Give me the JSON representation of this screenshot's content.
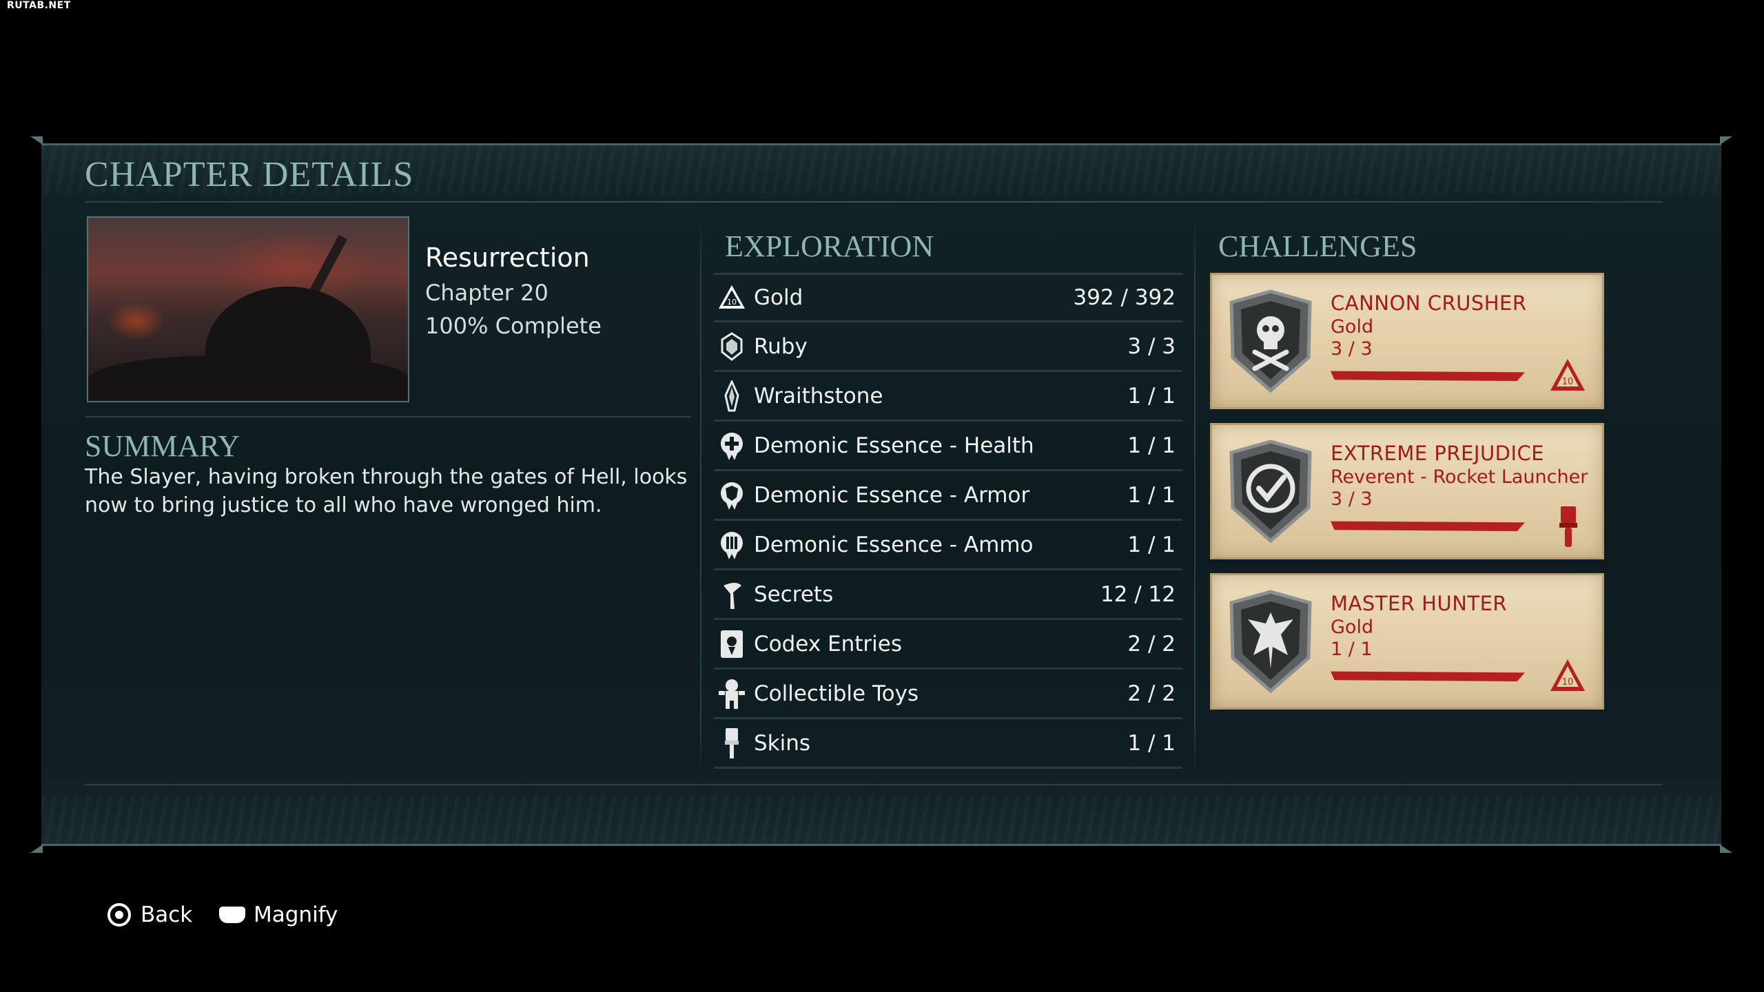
{
  "watermark": "RUTAB.NET",
  "title": "CHAPTER DETAILS",
  "chapter": {
    "name": "Resurrection",
    "number": "Chapter 20",
    "completion": "100% Complete"
  },
  "summary": {
    "heading": "SUMMARY",
    "text": "The Slayer, having broken through the gates of Hell, looks now to bring justice to all who have wronged him."
  },
  "exploration": {
    "heading": "EXPLORATION",
    "items": [
      {
        "label": "Gold",
        "count": "392 / 392",
        "icon": "gold-icon"
      },
      {
        "label": "Ruby",
        "count": "3 / 3",
        "icon": "ruby-icon"
      },
      {
        "label": "Wraithstone",
        "count": "1 / 1",
        "icon": "wraithstone-icon"
      },
      {
        "label": "Demonic Essence - Health",
        "count": "1 / 1",
        "icon": "health-essence-icon"
      },
      {
        "label": "Demonic Essence - Armor",
        "count": "1 / 1",
        "icon": "armor-essence-icon"
      },
      {
        "label": "Demonic Essence - Ammo",
        "count": "1 / 1",
        "icon": "ammo-essence-icon"
      },
      {
        "label": "Secrets",
        "count": "12 / 12",
        "icon": "secrets-icon"
      },
      {
        "label": "Codex Entries",
        "count": "2 / 2",
        "icon": "codex-icon"
      },
      {
        "label": "Collectible Toys",
        "count": "2 / 2",
        "icon": "toy-icon"
      },
      {
        "label": "Skins",
        "count": "1 / 1",
        "icon": "skin-brush-icon"
      }
    ]
  },
  "challenges": {
    "heading": "CHALLENGES",
    "items": [
      {
        "title": "CANNON CRUSHER",
        "reward": "Gold",
        "count": "3 / 3",
        "progress": 1.0,
        "badge": "skull-crossbones-badge-icon",
        "reward_icon": "gold-reward-icon"
      },
      {
        "title": "EXTREME PREJUDICE",
        "reward": "Reverent - Rocket Launcher",
        "count": "3 / 3",
        "progress": 1.0,
        "badge": "checkmark-badge-icon",
        "reward_icon": "paint-brush-reward-icon"
      },
      {
        "title": "MASTER HUNTER",
        "reward": "Gold",
        "count": "1 / 1",
        "progress": 1.0,
        "badge": "dragon-badge-icon",
        "reward_icon": "gold-reward-icon"
      }
    ]
  },
  "footer": {
    "back_label": "Back",
    "magnify_label": "Magnify"
  },
  "colors": {
    "accent_heading": "#8fb5b4",
    "card_text": "#a21a1a",
    "card_bg": "#e3cfa8",
    "panel_bg": "#0e1c20"
  }
}
